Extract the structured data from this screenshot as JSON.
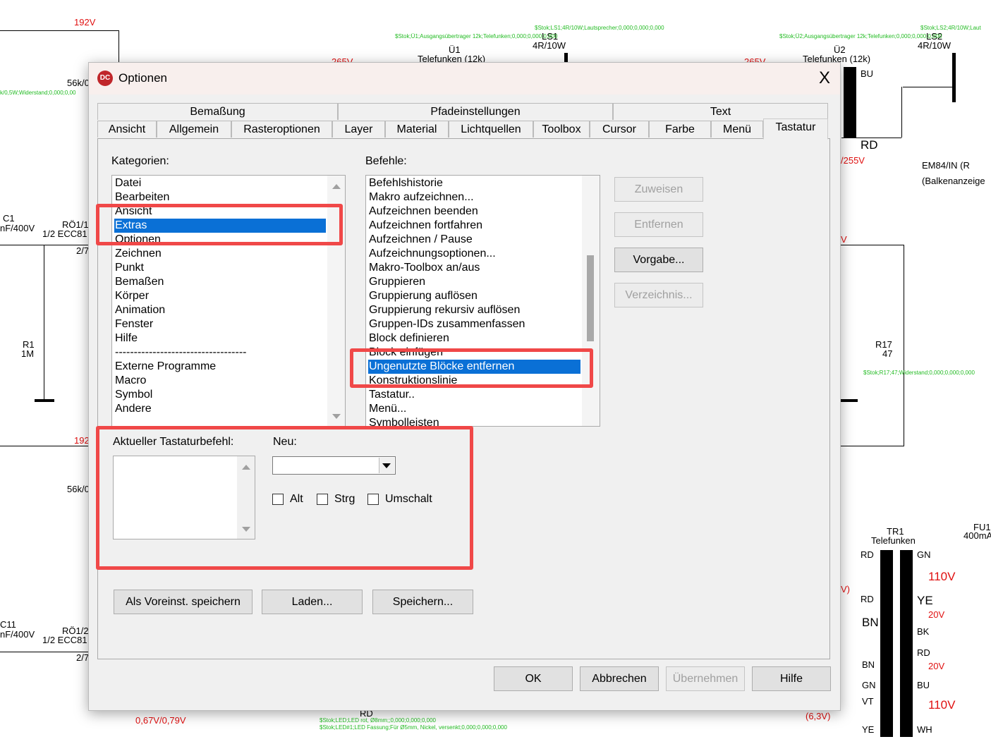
{
  "background": {
    "labels": [
      "192V",
      "265V",
      "265V",
      "Ü1",
      "Telefunken (12k)",
      "LS1",
      "4R/10W",
      "Ü2",
      "Telefunken (12k)",
      "LS2",
      "4R/10W",
      "56k/0",
      "C1",
      "nF/400V",
      "RÖ1/1",
      "1/2 ECC81",
      "2/7",
      "R1",
      "1M",
      "192",
      "56k/0",
      "C11",
      "nF/400V",
      "RÖ1/2",
      "1/2 ECC81",
      "2/7",
      "0,67V/0,79V",
      "RD",
      "BU",
      "RD",
      "/255V",
      "EM84/IN (R",
      "(Balkenanzeige",
      "V",
      "R17",
      "47",
      "TR1",
      "Telefunken",
      "FU1",
      "400mA",
      "RD",
      "GN",
      "110V",
      "RD",
      "YE",
      "20V",
      "BN",
      "BK",
      "RD",
      "BN",
      "20V",
      "GN",
      "BU",
      "VT",
      "110V",
      "YE",
      "WH",
      "(6,3V)",
      "V)"
    ],
    "green": [
      "$Stok;Ü1;Ausgangsübertrager 12k;Telefunken;0,000;0,000;0,000",
      "$Stok;LS1;4R/10W;Lautsprecher;0,000;0,000;0,000",
      "$Stok;Ü2;Ausgangsübertrager 12k;Telefunken;0,000;0,000;0,000",
      "$Stok;LS2;4R/10W;Laut",
      "k/0,5W;Widerstand;0,000;0,00",
      "$Stok;R17;47;Widerstand;0,000;0,000;0,000",
      "$Stok;LED;LED rot, Ø8mm;;0,000;0,000;0,000",
      "$Stok;LED#1;LED Fassung;Für Ø5mm, Nickel, versenkt;0,000;0,000;0,000"
    ]
  },
  "dialog": {
    "title": "Optionen",
    "logo": "DC",
    "close": "X",
    "tabs_row1": [
      "Bemaßung",
      "Pfadeinstellungen",
      "Text"
    ],
    "tabs_row2": [
      "Ansicht",
      "Allgemein",
      "Rasteroptionen",
      "Layer",
      "Material",
      "Lichtquellen",
      "Toolbox",
      "Cursor",
      "Farbe",
      "Menü",
      "Tastatur"
    ],
    "active_tab": "Tastatur",
    "categories_label": "Kategorien:",
    "categories": [
      "Datei",
      "Bearbeiten",
      "Ansicht",
      "Extras",
      "Optionen",
      "Zeichnen",
      "Punkt",
      "Bemaßen",
      "Körper",
      "Animation",
      "Fenster",
      "Hilfe",
      "-----------------------------------",
      "Externe Programme",
      "Macro",
      "Symbol",
      "Andere"
    ],
    "selected_category": "Extras",
    "commands_label": "Befehle:",
    "commands": [
      "Befehlshistorie",
      "Makro aufzeichnen...",
      "Aufzeichnen beenden",
      "Aufzeichnen fortfahren",
      "Aufzeichnen / Pause",
      "Aufzeichnungsoptionen...",
      "Makro-Toolbox an/aus",
      "Gruppieren",
      "Gruppierung auflösen",
      "Gruppierung rekursiv auflösen",
      "Gruppen-IDs zusammenfassen",
      "Block definieren",
      "Block einfügen",
      "Ungenutzte Blöcke entfernen",
      "Konstruktionslinie",
      "Tastatur..",
      "Menü...",
      "Symbolleisten"
    ],
    "selected_command": "Ungenutzte Blöcke entfernen",
    "side_buttons": {
      "assign": "Zuweisen",
      "remove": "Entfernen",
      "default": "Vorgabe...",
      "directory": "Verzeichnis..."
    },
    "current_label": "Aktueller Tastaturbefehl:",
    "new_label": "Neu:",
    "new_value": "",
    "modifiers": {
      "alt": "Alt",
      "strg": "Strg",
      "shift": "Umschalt"
    },
    "bottom": {
      "save_default": "Als Voreinst. speichern",
      "load": "Laden...",
      "save": "Speichern..."
    },
    "footer": {
      "ok": "OK",
      "cancel": "Abbrechen",
      "apply": "Übernehmen",
      "help": "Hilfe"
    },
    "highlight_color": "#f04848",
    "selection_color": "#0a70d6"
  }
}
